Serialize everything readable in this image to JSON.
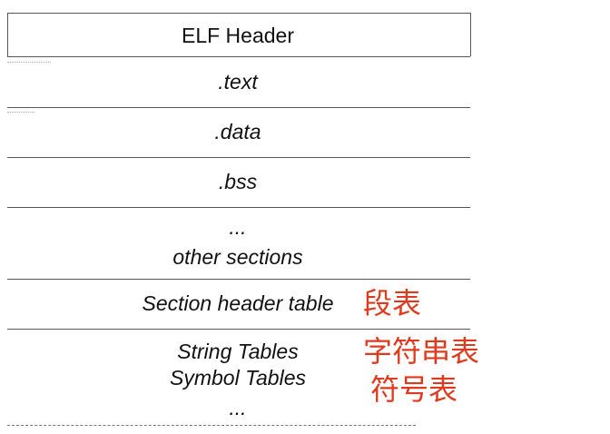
{
  "sections": [
    {
      "label": "ELF Header"
    },
    {
      "label": ".text"
    },
    {
      "label": ".data"
    },
    {
      "label": ".bss"
    },
    {
      "line1": "...",
      "line2": "other sections"
    },
    {
      "label": "Section header table"
    },
    {
      "line1": "String Tables",
      "line2": "Symbol Tables",
      "line3": "..."
    }
  ],
  "annotations": {
    "section_header_table": "段表",
    "string_tables": "字符串表",
    "symbol_tables": "符号表"
  },
  "colors": {
    "annotation": "#e03a1e",
    "lines": "#555555"
  }
}
